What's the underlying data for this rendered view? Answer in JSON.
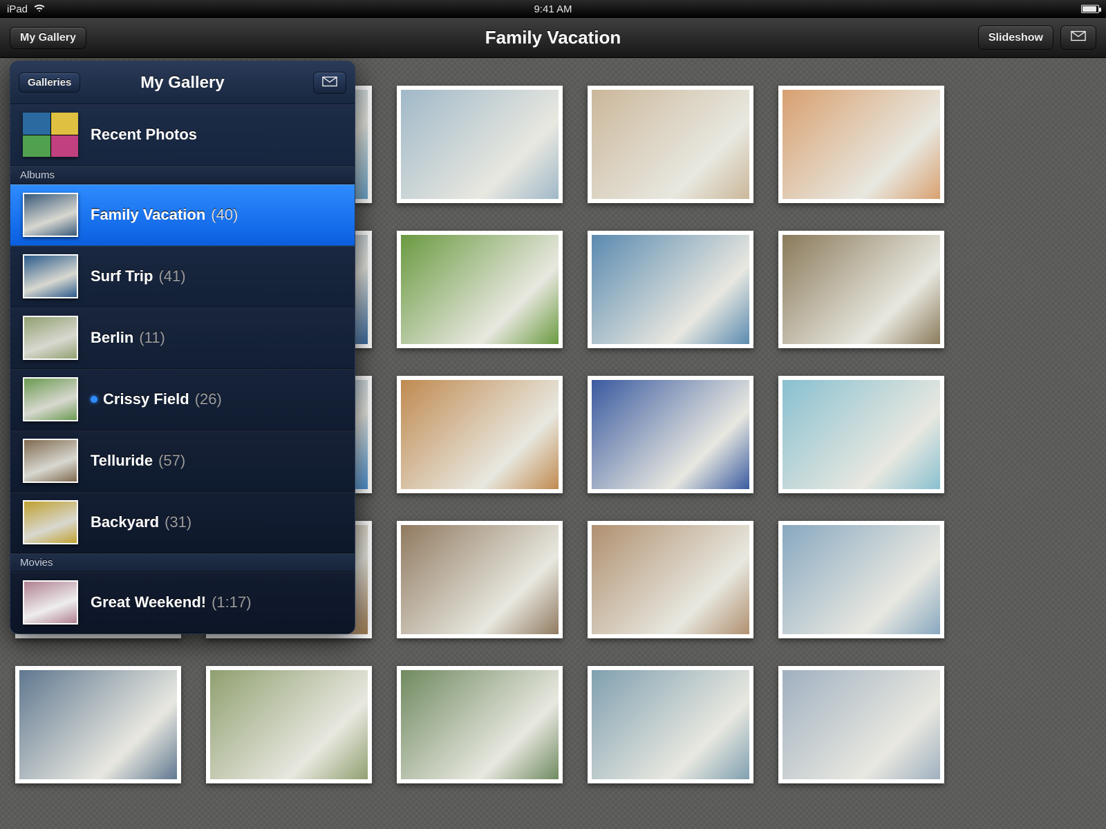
{
  "statusbar": {
    "device": "iPad",
    "time": "9:41 AM"
  },
  "navbar": {
    "back_label": "My Gallery",
    "title": "Family Vacation",
    "slideshow_label": "Slideshow"
  },
  "popover": {
    "back_label": "Galleries",
    "title": "My Gallery",
    "recent_label": "Recent Photos",
    "sections": {
      "albums_label": "Albums",
      "movies_label": "Movies"
    },
    "albums": [
      {
        "name": "Family Vacation",
        "count": "(40)",
        "selected": true,
        "has_dot": false
      },
      {
        "name": "Surf Trip",
        "count": "(41)",
        "selected": false,
        "has_dot": false
      },
      {
        "name": "Berlin",
        "count": "(11)",
        "selected": false,
        "has_dot": false
      },
      {
        "name": "Crissy Field",
        "count": "(26)",
        "selected": false,
        "has_dot": true
      },
      {
        "name": "Telluride",
        "count": "(57)",
        "selected": false,
        "has_dot": false
      },
      {
        "name": "Backyard",
        "count": "(31)",
        "selected": false,
        "has_dot": false
      }
    ],
    "movies": [
      {
        "name": "Great Weekend!",
        "count": "(1:17)"
      }
    ]
  },
  "thumb_colors": [
    [
      "#3a5a2a",
      "#6aa3c8",
      "#a0b8c8",
      "#cbb79a",
      "#d8a070"
    ],
    [
      "#7a5a3a",
      "#3a6aa0",
      "#6a9a40",
      "#5a8ab0",
      "#8a7a5a"
    ],
    [
      "#a0c4e8",
      "#4a90d0",
      "#c08a50",
      "#3a5aa0",
      "#88c0d0"
    ],
    [
      "#b08050",
      "#a07a50",
      "#907a60",
      "#b09070",
      "#88a8c0"
    ],
    [
      "#607890",
      "#90a070",
      "#708a60",
      "#80a0b0",
      "#a0b0c0"
    ]
  ],
  "album_thumb_colors": [
    "#3a5a7a",
    "#2a5a8a",
    "#90a070",
    "#6a9a50",
    "#806a50",
    "#c0a030"
  ],
  "movie_thumb_colors": [
    "#b08090"
  ]
}
